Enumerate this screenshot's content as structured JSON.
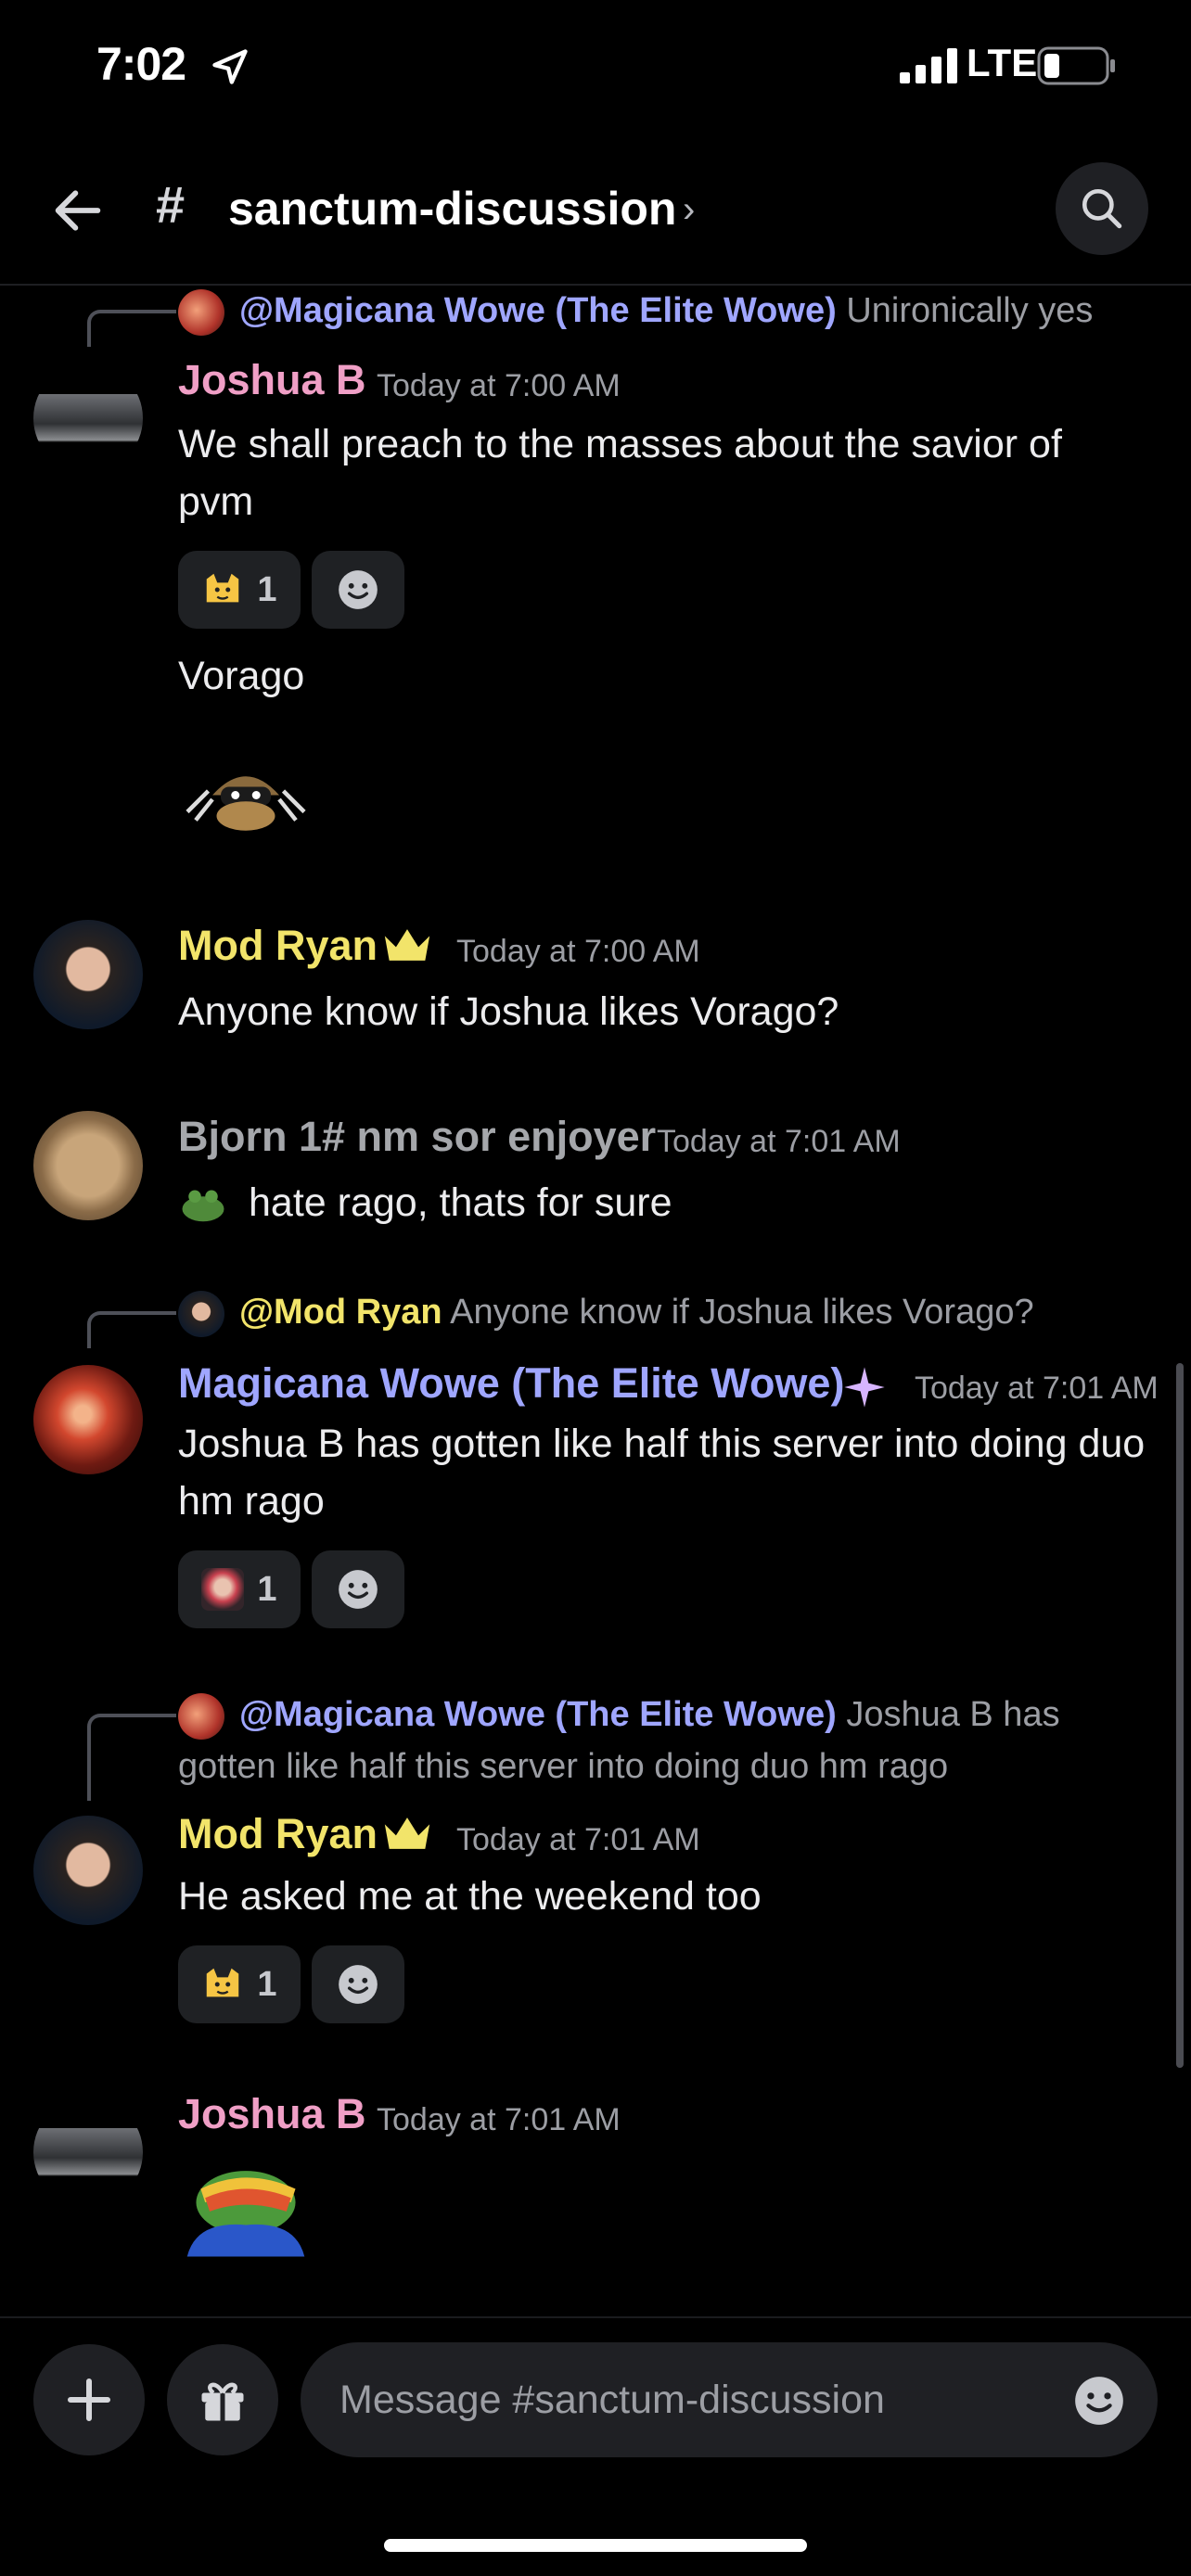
{
  "status": {
    "time": "7:02",
    "network": "LTE"
  },
  "header": {
    "hash": "#",
    "channel": "sanctum-discussion",
    "chevron": "›"
  },
  "messages": {
    "m1": {
      "reply_mention": "@Magicana Wowe (The Elite Wowe)",
      "reply_snippet": "Unironically yes",
      "author": "Joshua B",
      "author_color": "#f09fc6",
      "time": "Today at 7:00 AM",
      "text": "We shall preach to the masses about the savior of pvm",
      "reaction_count": "1",
      "text2": "Vorago"
    },
    "m2": {
      "author": "Mod Ryan",
      "author_color": "#f2e46a",
      "time": "Today at 7:00 AM",
      "text": "Anyone know if Joshua likes Vorago?"
    },
    "m3": {
      "author": "Bjorn 1# nm sor enjoyer",
      "author_color": "#a5a7ab",
      "time": "Today at 7:01 AM",
      "text": "hate rago, thats for sure"
    },
    "m4": {
      "reply_mention": "@Mod Ryan",
      "reply_snippet": "Anyone know if Joshua likes Vorago?",
      "author": "Magicana Wowe (The Elite Wowe)",
      "author_color": "#9fa6ff",
      "time": "Today at 7:01 AM",
      "text": "Joshua B has gotten like half this server into doing duo hm rago",
      "reaction_count": "1"
    },
    "m5": {
      "reply_mention": "@Magicana Wowe (The Elite Wowe)",
      "reply_snippet_line1": "Joshua B has",
      "reply_snippet_line2": "gotten like half this server into doing duo hm rago",
      "author": "Mod Ryan",
      "author_color": "#f2e46a",
      "time": "Today at 7:01 AM",
      "text": "He asked me at the weekend too",
      "reaction_count": "1"
    },
    "m6": {
      "author": "Joshua B",
      "author_color": "#f09fc6",
      "time": "Today at 7:01 AM"
    }
  },
  "composer": {
    "placeholder": "Message #sanctum-discussion"
  },
  "icons": [
    "location-arrow-icon",
    "signal-icon",
    "battery-icon",
    "back-arrow-icon",
    "search-icon",
    "plus-icon",
    "gift-icon",
    "emoji-icon",
    "add-reaction-icon",
    "crown-icon",
    "sparkle-badge-icon"
  ]
}
